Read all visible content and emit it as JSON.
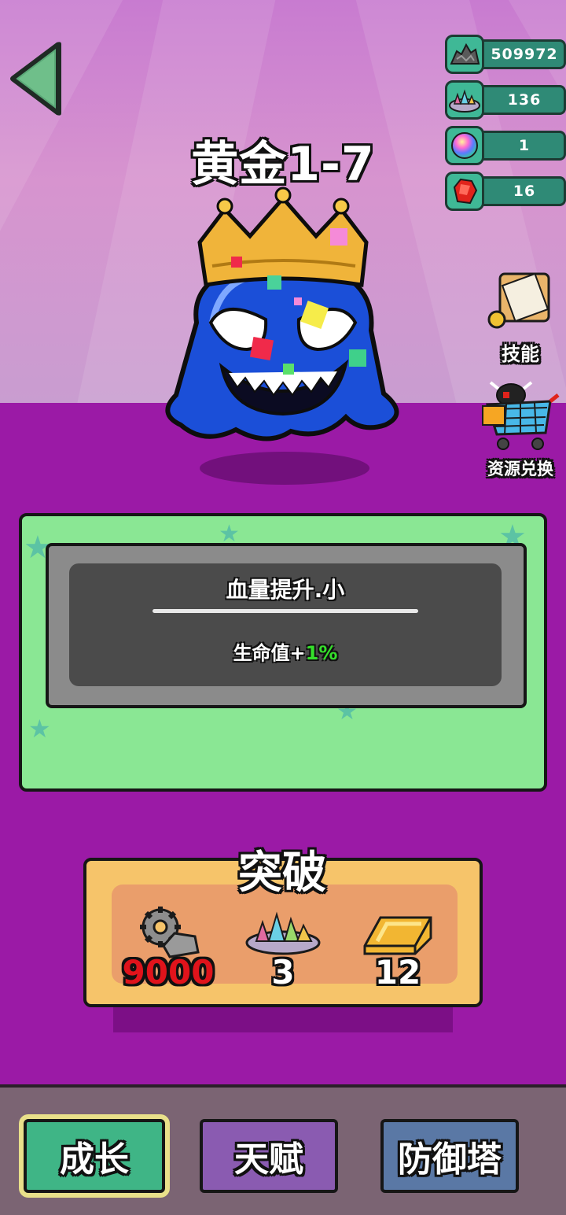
{
  "header": {
    "level_title": "黄金1-7",
    "back_icon": "back-arrow-icon"
  },
  "resources": [
    {
      "icon": "iron-ore-pile-icon",
      "value": "509972"
    },
    {
      "icon": "gem-crystals-pile-icon",
      "value": "136"
    },
    {
      "icon": "rainbow-orb-icon",
      "value": "1"
    },
    {
      "icon": "red-ruby-icon",
      "value": "16"
    }
  ],
  "side_buttons": {
    "skill_label": "技能",
    "exchange_label": "资源兑换"
  },
  "skill_card": {
    "name": "血量提升.小",
    "desc_prefix": "生命值+",
    "desc_value": "1%"
  },
  "breakthrough": {
    "title": "突破",
    "costs": [
      {
        "icon": "gear-ore-icon",
        "value": "9000",
        "insufficient": true
      },
      {
        "icon": "gem-crystals-pile-icon",
        "value": "3"
      },
      {
        "icon": "gold-bar-icon",
        "value": "12"
      }
    ]
  },
  "tabs": {
    "growth": "成长",
    "talent": "天赋",
    "tower": "防御塔"
  },
  "colors": {
    "background_purple": "#9b1aa6",
    "card_green": "#8ae794",
    "tab_active": "#3fb586",
    "cost_insufficient": "#e0131b",
    "stat_bonus": "#35e02b"
  }
}
